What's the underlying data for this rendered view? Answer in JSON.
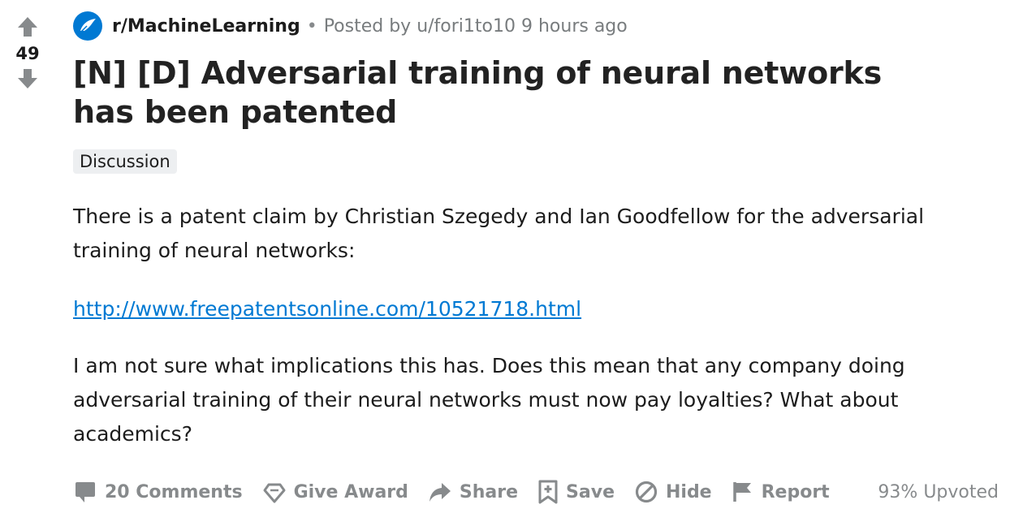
{
  "vote": {
    "count": "49"
  },
  "post": {
    "subreddit": "r/MachineLearning",
    "separator": "•",
    "posted_by": "Posted by u/fori1to10 9 hours ago",
    "title": "[N] [D] Adversarial training of neural networks has been patented",
    "flair": "Discussion",
    "paragraph_1": "There is a patent claim by Christian Szegedy and Ian Goodfellow for the adversarial training of neural networks:",
    "link": "http://www.freepatentsonline.com/10521718.html",
    "paragraph_2": "I am not sure what implications this has. Does this mean that any company doing adversarial training of their neural networks must now pay loyalties? What about academics?"
  },
  "actions": {
    "comments": "20 Comments",
    "award": "Give Award",
    "share": "Share",
    "save": "Save",
    "hide": "Hide",
    "report": "Report",
    "upvoted": "93% Upvoted"
  },
  "icons": {
    "upvote": "upvote-arrow-icon",
    "downvote": "downvote-arrow-icon",
    "subreddit": "subreddit-icon",
    "comments": "comment-bubble-icon",
    "award": "award-icon",
    "share": "share-arrow-icon",
    "save": "bookmark-plus-icon",
    "hide": "hide-circle-icon",
    "report": "flag-icon"
  },
  "colors": {
    "accent": "#0079d3",
    "muted": "#878a8c",
    "flair_bg": "#edeff1"
  }
}
